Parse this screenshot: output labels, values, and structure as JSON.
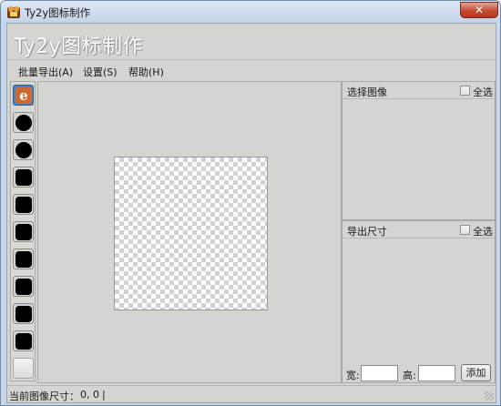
{
  "window": {
    "title": "Ty2y图标制作",
    "close_glyph": "✕",
    "app_icon": "app-icon"
  },
  "banner": {
    "title": "Ty2y图标制作"
  },
  "menu": {
    "items": [
      {
        "label": "批量导出(A)"
      },
      {
        "label": "设置(S)"
      },
      {
        "label": "帮助(H)"
      }
    ]
  },
  "rail": {
    "items": [
      {
        "icon": "ie-icon",
        "glyph": "e",
        "selected": true
      },
      {
        "icon": "circle-icon"
      },
      {
        "icon": "circle-icon"
      },
      {
        "icon": "rounded-square-icon"
      },
      {
        "icon": "rounded-square-icon"
      },
      {
        "icon": "rounded-square-icon"
      },
      {
        "icon": "rounded-square-icon"
      },
      {
        "icon": "rounded-square-icon"
      },
      {
        "icon": "rounded-square-icon"
      },
      {
        "icon": "rounded-square-icon"
      },
      {
        "icon": "blank-icon"
      }
    ]
  },
  "select_image": {
    "title": "选择图像",
    "select_all": "全选"
  },
  "export_size": {
    "title": "导出尺寸",
    "select_all": "全选",
    "width_label": "宽:",
    "width_value": "",
    "height_label": "高:",
    "height_value": "",
    "add_label": "添加"
  },
  "status": {
    "label": "当前图像尺寸：",
    "value": "0, 0",
    "separator": "|"
  }
}
